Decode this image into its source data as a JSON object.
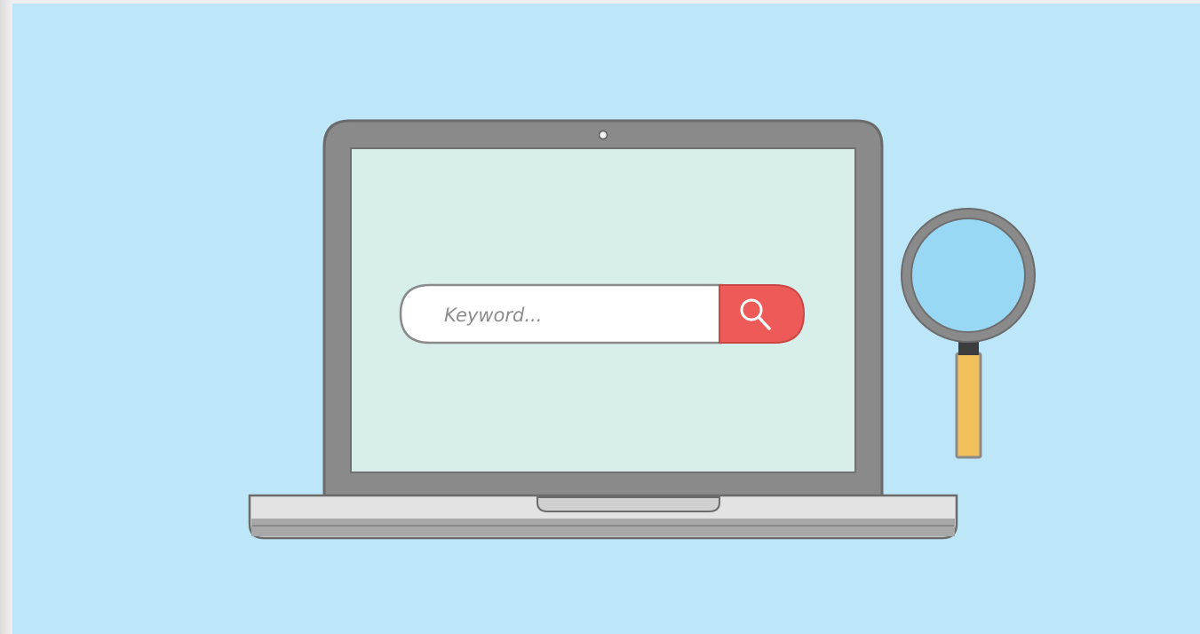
{
  "search": {
    "placeholder": "Keyword..."
  },
  "icons": {
    "search_button_icon": "search-icon",
    "magnifier": "magnifying-glass-icon",
    "camera": "webcam-icon"
  },
  "colors": {
    "background": "#bde6f9",
    "screen": "#d7eeeb",
    "bezel": "#8a8a8a",
    "search_button": "#ee5a57",
    "lens": "#98d8f4",
    "handle": "#f3c15b"
  }
}
